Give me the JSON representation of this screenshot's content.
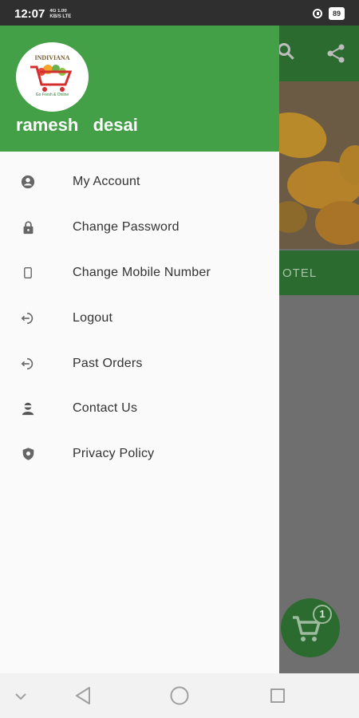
{
  "status_bar": {
    "time": "12:07",
    "network_line1": "4G  1.00",
    "network_line2": "KB/S  LTE",
    "battery": "89"
  },
  "background": {
    "tab_text": "OTEL",
    "cart_badge": "1"
  },
  "drawer": {
    "logo": {
      "brand": "INDIVIANA",
      "tagline": "Go Fresh & Online"
    },
    "user_name": "ramesh   desai",
    "menu": [
      {
        "label": "My Account",
        "icon": "account-circle-icon"
      },
      {
        "label": "Change Password",
        "icon": "lock-icon"
      },
      {
        "label": "Change Mobile Number",
        "icon": "phone-icon"
      },
      {
        "label": "Logout",
        "icon": "logout-icon"
      },
      {
        "label": "Past Orders",
        "icon": "past-orders-icon"
      },
      {
        "label": "Contact Us",
        "icon": "contact-icon"
      },
      {
        "label": "Privacy Policy",
        "icon": "shield-icon"
      }
    ]
  },
  "colors": {
    "header_green": "#43a047",
    "dim_green": "#2b6b2f",
    "drawer_bg": "#fafafa"
  }
}
